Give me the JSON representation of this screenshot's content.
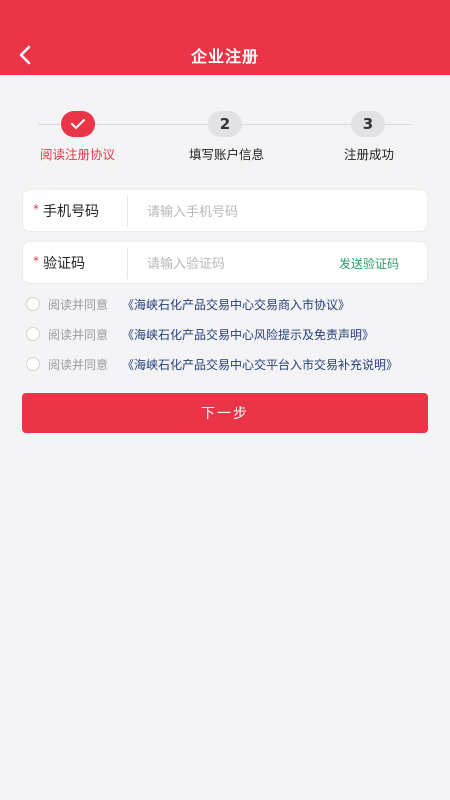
{
  "header": {
    "title": "企业注册",
    "back_icon": "chevron-left-icon"
  },
  "steps": [
    {
      "number": "",
      "icon": "check-icon",
      "label": "阅读注册协议",
      "active": true
    },
    {
      "number": "2",
      "label": "填写账户信息",
      "active": false
    },
    {
      "number": "3",
      "label": "注册成功",
      "active": false
    }
  ],
  "phone": {
    "required_mark": "*",
    "label": "手机号码",
    "placeholder": "请输入手机号码"
  },
  "code": {
    "required_mark": "*",
    "label": "验证码",
    "placeholder": "请输入验证码",
    "send_label": "发送验证码"
  },
  "agreements": [
    {
      "prefix": "阅读并同意",
      "link": "《海峡石化产品交易中心交易商入市协议》"
    },
    {
      "prefix": "阅读并同意",
      "link": "《海峡石化产品交易中心风险提示及免责声明》"
    },
    {
      "prefix": "阅读并同意",
      "link": "《海峡石化产品交易中心交平台入市交易补充说明》"
    }
  ],
  "next_button": "下一步",
  "colors": {
    "brand": "#ea3447",
    "link": "#243f77",
    "send_code": "#2aa06a"
  }
}
